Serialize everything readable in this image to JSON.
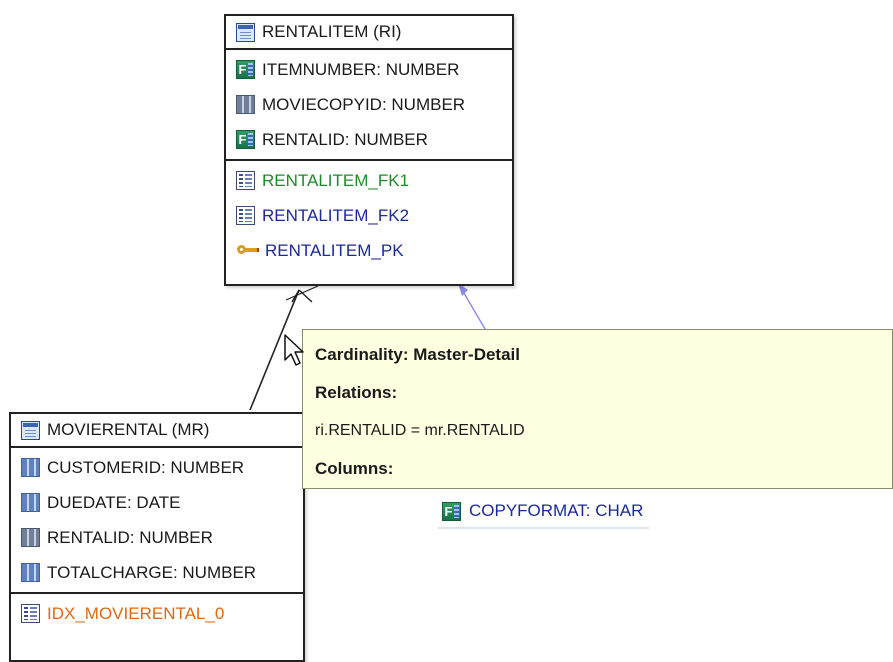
{
  "colors": {
    "border": "#222222",
    "tooltip_bg": "#ffffe1",
    "fk_green": "#1f8a2c",
    "index_navy": "#1b2a9a",
    "index_orange": "#e06810",
    "link_blue": "#8a8ae6"
  },
  "rentalitem": {
    "title": "RENTALITEM (RI)",
    "icon": "table-icon",
    "columns": [
      {
        "label": "ITEMNUMBER: NUMBER",
        "icon": "fk-column-icon"
      },
      {
        "label": "MOVIECOPYID: NUMBER",
        "icon": "column-icon"
      },
      {
        "label": "RENTALID: NUMBER",
        "icon": "fk-column-icon"
      }
    ],
    "constraints": [
      {
        "label": "RENTALITEM_FK1",
        "icon": "index-icon"
      },
      {
        "label": "RENTALITEM_FK2",
        "icon": "index-icon"
      },
      {
        "label": "RENTALITEM_PK",
        "icon": "key-icon"
      }
    ]
  },
  "movierental": {
    "title": "MOVIERENTAL (MR)",
    "icon": "table-icon",
    "columns": [
      {
        "label": "CUSTOMERID: NUMBER",
        "icon": "column-icon"
      },
      {
        "label": "DUEDATE: DATE",
        "icon": "column-icon"
      },
      {
        "label": "RENTALID: NUMBER",
        "icon": "column-icon"
      },
      {
        "label": "TOTALCHARGE: NUMBER",
        "icon": "column-icon"
      }
    ],
    "indexes": [
      {
        "label": "IDX_MOVIERENTAL_0",
        "icon": "index-icon"
      }
    ]
  },
  "tooltip": {
    "cardinality": "Cardinality: Master-Detail",
    "relations_heading": "Relations:",
    "relation": "ri.RENTALID = mr.RENTALID",
    "columns_heading": "Columns:"
  },
  "floating_column": {
    "label": "COPYFORMAT: CHAR",
    "icon": "fk-column-icon"
  }
}
